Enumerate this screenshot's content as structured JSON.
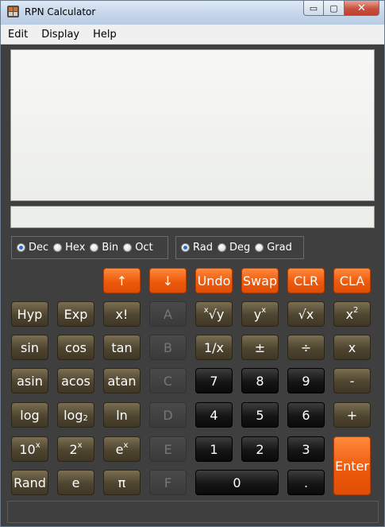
{
  "window": {
    "title": "RPN Calculator"
  },
  "titlebar_buttons": {
    "minimize": "▭",
    "maximize": "▢",
    "close": "✕"
  },
  "menu": {
    "items": [
      "Edit",
      "Display",
      "Help"
    ]
  },
  "display": {
    "stack": "",
    "entry": ""
  },
  "base_options": [
    {
      "label": "Dec",
      "selected": true
    },
    {
      "label": "Hex",
      "selected": false
    },
    {
      "label": "Bin",
      "selected": false
    },
    {
      "label": "Oct",
      "selected": false
    }
  ],
  "angle_options": [
    {
      "label": "Rad",
      "selected": true
    },
    {
      "label": "Deg",
      "selected": false
    },
    {
      "label": "Grad",
      "selected": false
    }
  ],
  "keys": {
    "up": "↑",
    "down": "↓",
    "undo": "Undo",
    "swap": "Swap",
    "clr": "CLR",
    "cla": "CLA",
    "hyp": "Hyp",
    "exp": "Exp",
    "fact": "x!",
    "hex_a": "A",
    "xroot_x": "x",
    "xroot_rest": "√y",
    "ypow_base": "y",
    "ypow_exp": "x",
    "sqrt": "√x",
    "sq_base": "x",
    "sq_exp": "2",
    "sin": "sin",
    "cos": "cos",
    "tan": "tan",
    "hex_b": "B",
    "inv": "1/x",
    "neg": "±",
    "div": "÷",
    "mul": "x",
    "asin": "asin",
    "acos": "acos",
    "atan": "atan",
    "hex_c": "C",
    "d7": "7",
    "d8": "8",
    "d9": "9",
    "sub": "-",
    "log": "log",
    "log2_base": "log",
    "log2_sub": "2",
    "ln": "ln",
    "hex_d": "D",
    "d4": "4",
    "d5": "5",
    "d6": "6",
    "add": "+",
    "pow10_base": "10",
    "pow10_exp": "x",
    "pow2_base": "2",
    "pow2_exp": "x",
    "powe_base": "e",
    "powe_exp": "x",
    "hex_e": "E",
    "d1": "1",
    "d2": "2",
    "d3": "3",
    "enter": "Enter",
    "rand": "Rand",
    "e": "e",
    "pi": "π",
    "hex_f": "F",
    "d0": "0",
    "dot": "."
  },
  "colors": {
    "accent": "#ee5a0c",
    "function_key": "#4e4530",
    "digit_key": "#151515",
    "background": "#3f3f3f"
  }
}
